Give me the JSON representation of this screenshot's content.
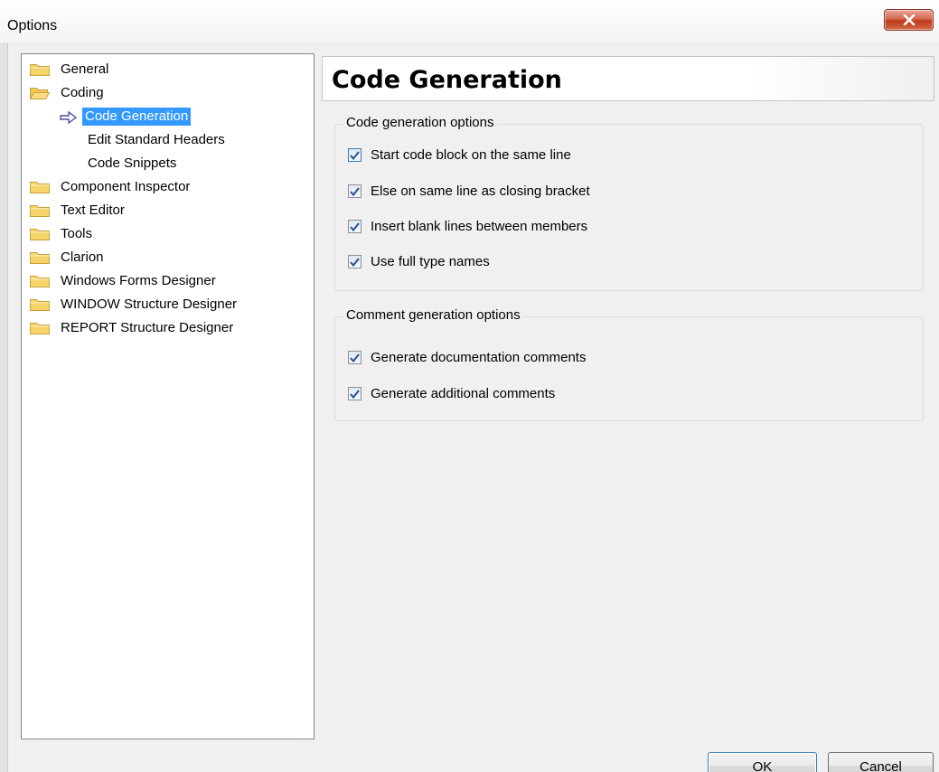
{
  "window": {
    "title": "Options"
  },
  "tree": {
    "items": [
      {
        "label": "General",
        "icon": "folder-closed-icon",
        "selected": false
      },
      {
        "label": "Coding",
        "icon": "folder-open-icon",
        "selected": false
      },
      {
        "label": "Code Generation",
        "icon": "arrow-right-icon",
        "selected": true
      },
      {
        "label": "Edit Standard Headers",
        "icon": "",
        "selected": false
      },
      {
        "label": "Code Snippets",
        "icon": "",
        "selected": false
      },
      {
        "label": "Component Inspector",
        "icon": "folder-closed-icon",
        "selected": false
      },
      {
        "label": "Text Editor",
        "icon": "folder-closed-icon",
        "selected": false
      },
      {
        "label": "Tools",
        "icon": "folder-closed-icon",
        "selected": false
      },
      {
        "label": "Clarion",
        "icon": "folder-closed-icon",
        "selected": false
      },
      {
        "label": "Windows Forms Designer",
        "icon": "folder-closed-icon",
        "selected": false
      },
      {
        "label": "WINDOW Structure Designer",
        "icon": "folder-closed-icon",
        "selected": false
      },
      {
        "label": "REPORT Structure Designer",
        "icon": "folder-closed-icon",
        "selected": false
      }
    ]
  },
  "panel": {
    "title": "Code Generation",
    "code_group": {
      "title": "Code generation options",
      "options": [
        {
          "label": "Start code block on the same line",
          "checked": true
        },
        {
          "label": "Else on same line as closing bracket",
          "checked": true
        },
        {
          "label": "Insert blank lines between members",
          "checked": true
        },
        {
          "label": "Use full type names",
          "checked": true
        }
      ]
    },
    "comment_group": {
      "title": "Comment generation options",
      "options": [
        {
          "label": "Generate documentation comments",
          "checked": true
        },
        {
          "label": "Generate additional comments",
          "checked": true
        }
      ]
    }
  },
  "buttons": {
    "ok": "OK",
    "cancel": "Cancel"
  },
  "colors": {
    "selection": "#3399ff",
    "folder": "#f5d46a",
    "close_button": "#c7432a",
    "check_mark": "#2b4f8f"
  }
}
